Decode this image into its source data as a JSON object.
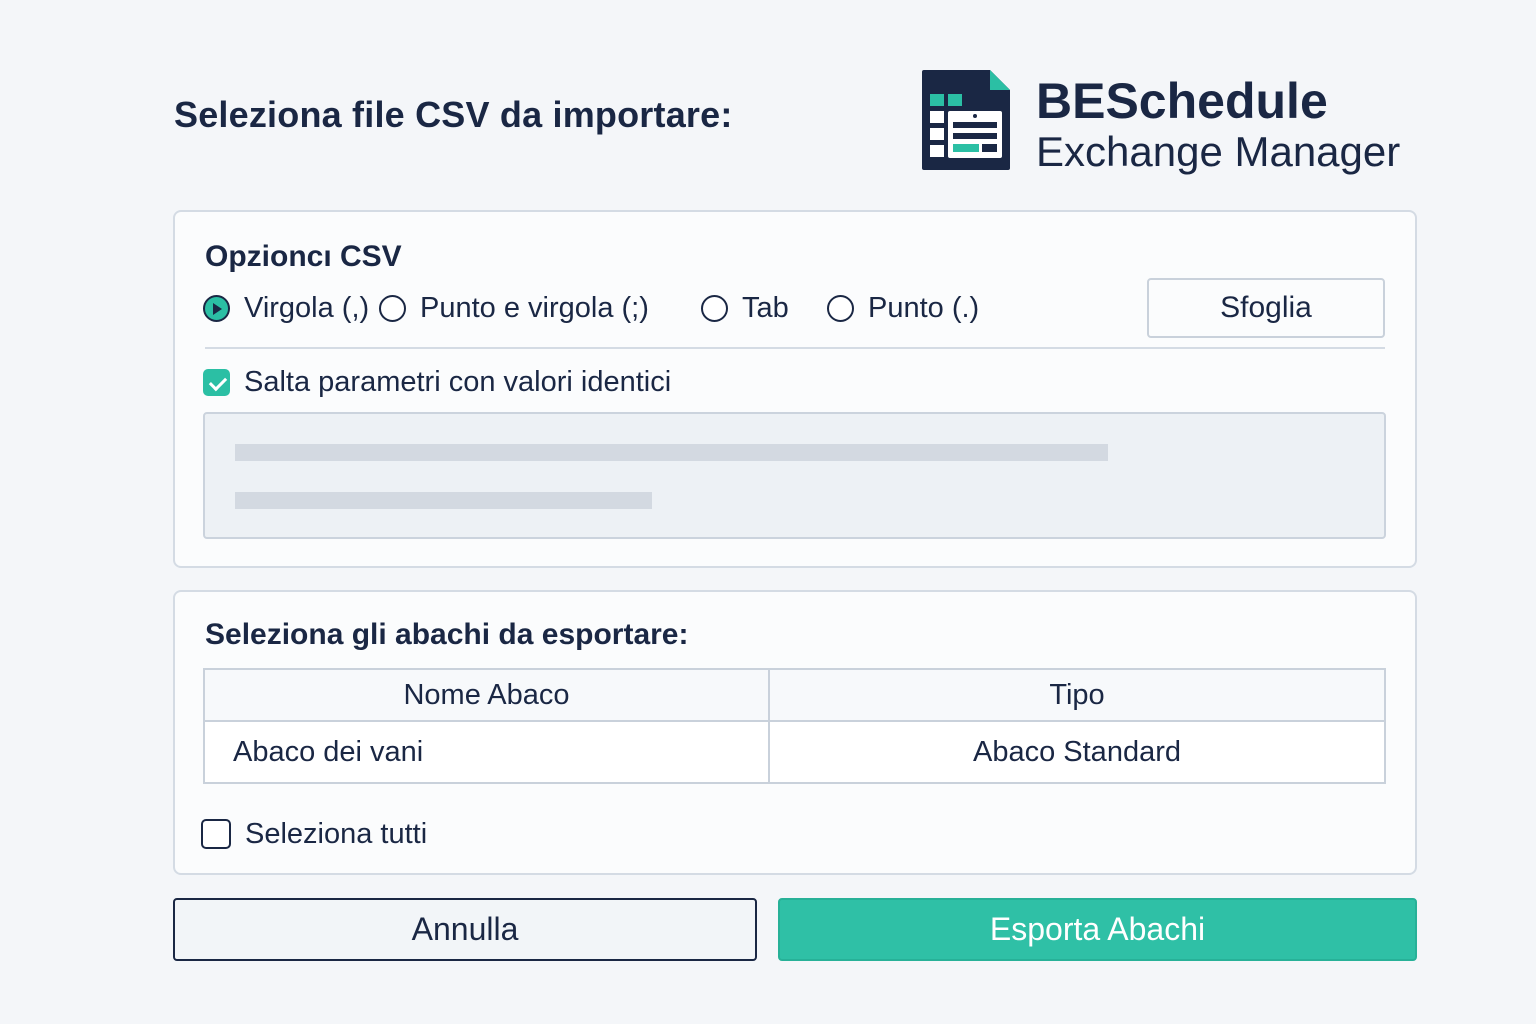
{
  "header": {
    "import_title": "Seleziona file CSV da importare:"
  },
  "brand": {
    "name": "BESchedule",
    "subtitle": "Exchange Manager",
    "logo_icon": "schedule-document-icon",
    "accent_color": "#2bbfa4",
    "dark_color": "#1a2744"
  },
  "csv_options": {
    "title": "Opzioncı CSV",
    "separators": [
      {
        "label": "Virgola (,)",
        "selected": true
      },
      {
        "label": "Punto e virgola (;)",
        "selected": false
      },
      {
        "label": "Tab",
        "selected": false
      },
      {
        "label": "Punto (.)",
        "selected": false
      }
    ],
    "browse_label": "Sfoglia",
    "skip_identical_label": "Salta parametri con valori identici",
    "skip_identical_checked": true
  },
  "schedules": {
    "title": "Seleziona gli abachi da esportare:",
    "columns": [
      "Nome Abaco",
      "Tipo"
    ],
    "rows": [
      {
        "name": "Abaco dei vani",
        "type": "Abaco Standard"
      }
    ],
    "select_all_label": "Seleziona tutti",
    "select_all_checked": false
  },
  "actions": {
    "cancel_label": "Annulla",
    "export_label": "Esporta Abachi"
  }
}
